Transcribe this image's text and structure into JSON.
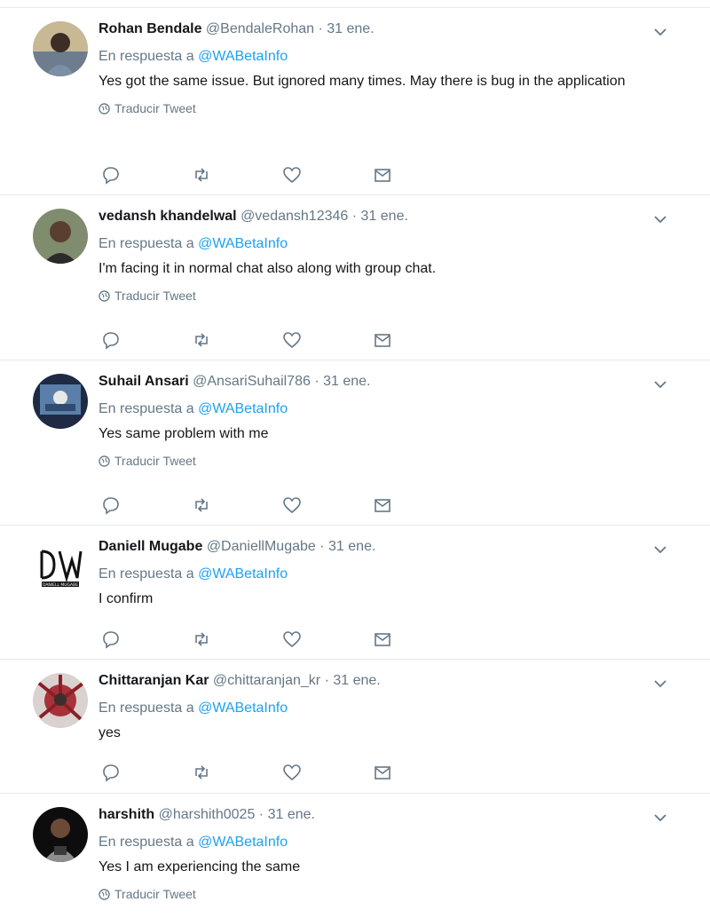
{
  "reply_prefix": "En respuesta a",
  "translate_label": "Traducir Tweet",
  "tweets": [
    {
      "name": "Rohan Bendale",
      "handle": "@BendaleRohan",
      "date": "31 ene.",
      "reply_to": "@WABetaInfo",
      "text": "Yes got the same issue. But ignored many times. May there is bug in the application",
      "translate": "Traducir Tweet"
    },
    {
      "name": "vedansh khandelwal",
      "handle": "@vedansh12346",
      "date": "31 ene.",
      "reply_to": "@WABetaInfo",
      "text": "I'm facing it in normal chat also along with group chat.",
      "translate": "Traducir Tweet"
    },
    {
      "name": "Suhail Ansari",
      "handle": "@AnsariSuhail786",
      "date": "31 ene.",
      "reply_to": "@WABetaInfo",
      "text": "Yes same problem with me",
      "translate": "Traducir Tweet"
    },
    {
      "name": "Daniell Mugabe",
      "handle": "@DaniellMugabe",
      "date": "31 ene.",
      "reply_to": "@WABetaInfo",
      "text": "I confirm",
      "avatar_text": "DANIELL MUGABE"
    },
    {
      "name": "Chittaranjan Kar",
      "handle": "@chittaranjan_kr",
      "date": "31 ene.",
      "reply_to": "@WABetaInfo",
      "text": "yes"
    },
    {
      "name": "harshith",
      "handle": "@harshith0025",
      "date": "31 ene.",
      "reply_to": "@WABetaInfo",
      "text": "Yes I am experiencing the same",
      "translate": "Traducir Tweet"
    }
  ],
  "icons": {
    "reply": "reply-icon",
    "retweet": "retweet-icon",
    "like": "heart-icon",
    "dm": "envelope-icon",
    "caret": "chevron-down-icon",
    "globe": "globe-icon"
  },
  "colors": {
    "link": "#1da1f2",
    "muted": "#657786",
    "divider": "#e6ecf0"
  }
}
